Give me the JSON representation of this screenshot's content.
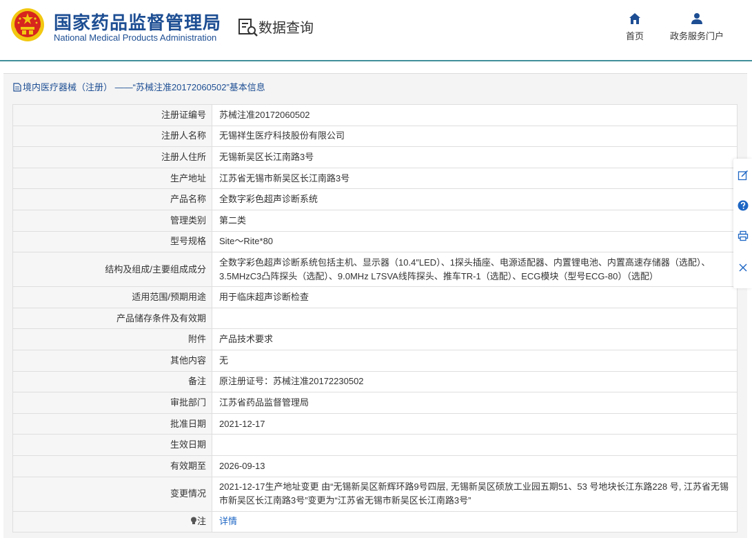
{
  "header": {
    "org_name_cn": "国家药品监督管理局",
    "org_name_en": "National Medical Products Administration",
    "query_title": "数据查询",
    "nav": [
      {
        "label": "首页",
        "icon": "home-icon"
      },
      {
        "label": "政务服务门户",
        "icon": "user-icon"
      }
    ]
  },
  "panel": {
    "title": "境内医疗器械（注册） ——“苏械注准20172060502”基本信息"
  },
  "rows": [
    {
      "label": "注册证编号",
      "value": "苏械注准20172060502"
    },
    {
      "label": "注册人名称",
      "value": "无锡祥生医疗科技股份有限公司"
    },
    {
      "label": "注册人住所",
      "value": "无锡新吴区长江南路3号"
    },
    {
      "label": "生产地址",
      "value": "江苏省无锡市新吴区长江南路3号"
    },
    {
      "label": "产品名称",
      "value": "全数字彩色超声诊断系统"
    },
    {
      "label": "管理类别",
      "value": "第二类"
    },
    {
      "label": "型号规格",
      "value": "Site～Rite*80"
    },
    {
      "label": "结构及组成/主要组成成分",
      "value": "全数字彩色超声诊断系统包括主机、显示器（10.4″LED）、1探头插座、电源适配器、内置锂电池、内置高速存储器（选配）、3.5MHzC3凸阵探头（选配）、9.0MHz L7SVA线阵探头、推车TR-1（选配）、ECG模块（型号ECG-80）（选配）"
    },
    {
      "label": "适用范围/预期用途",
      "value": "用于临床超声诊断检查"
    },
    {
      "label": "产品储存条件及有效期",
      "value": ""
    },
    {
      "label": "附件",
      "value": "产品技术要求"
    },
    {
      "label": "其他内容",
      "value": "无"
    },
    {
      "label": "备注",
      "value": "原注册证号：苏械注准20172230502"
    },
    {
      "label": "审批部门",
      "value": "江苏省药品监督管理局"
    },
    {
      "label": "批准日期",
      "value": "2021-12-17"
    },
    {
      "label": "生效日期",
      "value": ""
    },
    {
      "label": "有效期至",
      "value": "2026-09-13"
    },
    {
      "label": "变更情况",
      "value": "2021-12-17生产地址变更 由“无锡新吴区新辉环路9号四层, 无锡新吴区硕放工业园五期51、53 号地块长江东路228 号, 江苏省无锡市新吴区长江南路3号”变更为“江苏省无锡市新吴区长江南路3号”"
    },
    {
      "label": "注",
      "value": "详情",
      "label_icon": "bulb-icon"
    }
  ],
  "colors": {
    "brand_blue": "#1d4e93",
    "header_line": "#3f8e9a",
    "link": "#1d66c4",
    "emblem_red": "#d7261d",
    "emblem_gold": "#f2c811"
  },
  "side_tools": [
    "edit-icon",
    "help-icon",
    "print-icon",
    "close-icon"
  ]
}
